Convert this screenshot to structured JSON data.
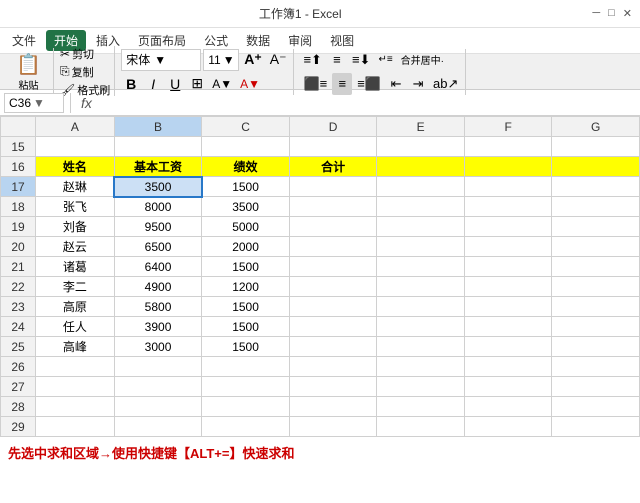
{
  "title_bar": {
    "filename": "工作簿1 - Excel",
    "start_btn": "开始"
  },
  "menu": {
    "items": [
      "文件",
      "开始",
      "插入",
      "页面布局",
      "公式",
      "数据",
      "审阅",
      "视图"
    ]
  },
  "ribbon": {
    "paste_label": "粘贴",
    "cut_label": "剪切",
    "copy_label": "复制",
    "format_label": "格式刷",
    "font_name": "宋体",
    "font_size": "11",
    "bold": "B",
    "italic": "I",
    "underline": "U",
    "merge_label": "合并居中·"
  },
  "formula_bar": {
    "cell_ref": "C36",
    "fx": "fx",
    "formula": ""
  },
  "headers": {
    "row_num_placeholder": "",
    "cols": [
      "A",
      "B",
      "C",
      "D",
      "E",
      "F",
      "G"
    ]
  },
  "rows": [
    {
      "num": "15",
      "cells": [
        "",
        "",
        "",
        "",
        "",
        "",
        ""
      ]
    },
    {
      "num": "16",
      "cells": [
        "姓名",
        "基本工资",
        "绩效",
        "合计",
        "",
        "",
        ""
      ],
      "style": "header"
    },
    {
      "num": "17",
      "cells": [
        "赵琳",
        "3500",
        "1500",
        "",
        "",
        "",
        ""
      ],
      "b_selected": true
    },
    {
      "num": "18",
      "cells": [
        "张飞",
        "8000",
        "3500",
        "",
        "",
        "",
        ""
      ]
    },
    {
      "num": "19",
      "cells": [
        "刘备",
        "9500",
        "5000",
        "",
        "",
        "",
        ""
      ]
    },
    {
      "num": "20",
      "cells": [
        "赵云",
        "6500",
        "2000",
        "",
        "",
        "",
        ""
      ]
    },
    {
      "num": "21",
      "cells": [
        "诸葛",
        "6400",
        "1500",
        "",
        "",
        "",
        ""
      ]
    },
    {
      "num": "22",
      "cells": [
        "李二",
        "4900",
        "1200",
        "",
        "",
        "",
        ""
      ]
    },
    {
      "num": "23",
      "cells": [
        "高原",
        "5800",
        "1500",
        "",
        "",
        "",
        ""
      ]
    },
    {
      "num": "24",
      "cells": [
        "任人",
        "3900",
        "1500",
        "",
        "",
        "",
        ""
      ]
    },
    {
      "num": "25",
      "cells": [
        "高峰",
        "3000",
        "1500",
        "",
        "",
        "",
        ""
      ]
    },
    {
      "num": "26",
      "cells": [
        "",
        "",
        "",
        "",
        "",
        "",
        ""
      ]
    },
    {
      "num": "27",
      "cells": [
        "",
        "",
        "",
        "",
        "",
        "",
        ""
      ]
    },
    {
      "num": "28",
      "cells": [
        "",
        "",
        "",
        "",
        "",
        "",
        ""
      ]
    },
    {
      "num": "29",
      "cells": [
        "",
        "",
        "",
        "",
        "",
        "",
        ""
      ]
    }
  ],
  "bottom_text": "先选中求和区域→使用快捷键【ALT+=】快速求和",
  "colors": {
    "header_bg": "#ffff00",
    "selected_cell": "#cce0f5",
    "row_header_bg": "#f2f2f2",
    "col_selected": "#b8d4f0",
    "start_btn_bg": "#217346",
    "ribbon_bg": "#f0f0f0",
    "red_text": "#cc0000"
  }
}
